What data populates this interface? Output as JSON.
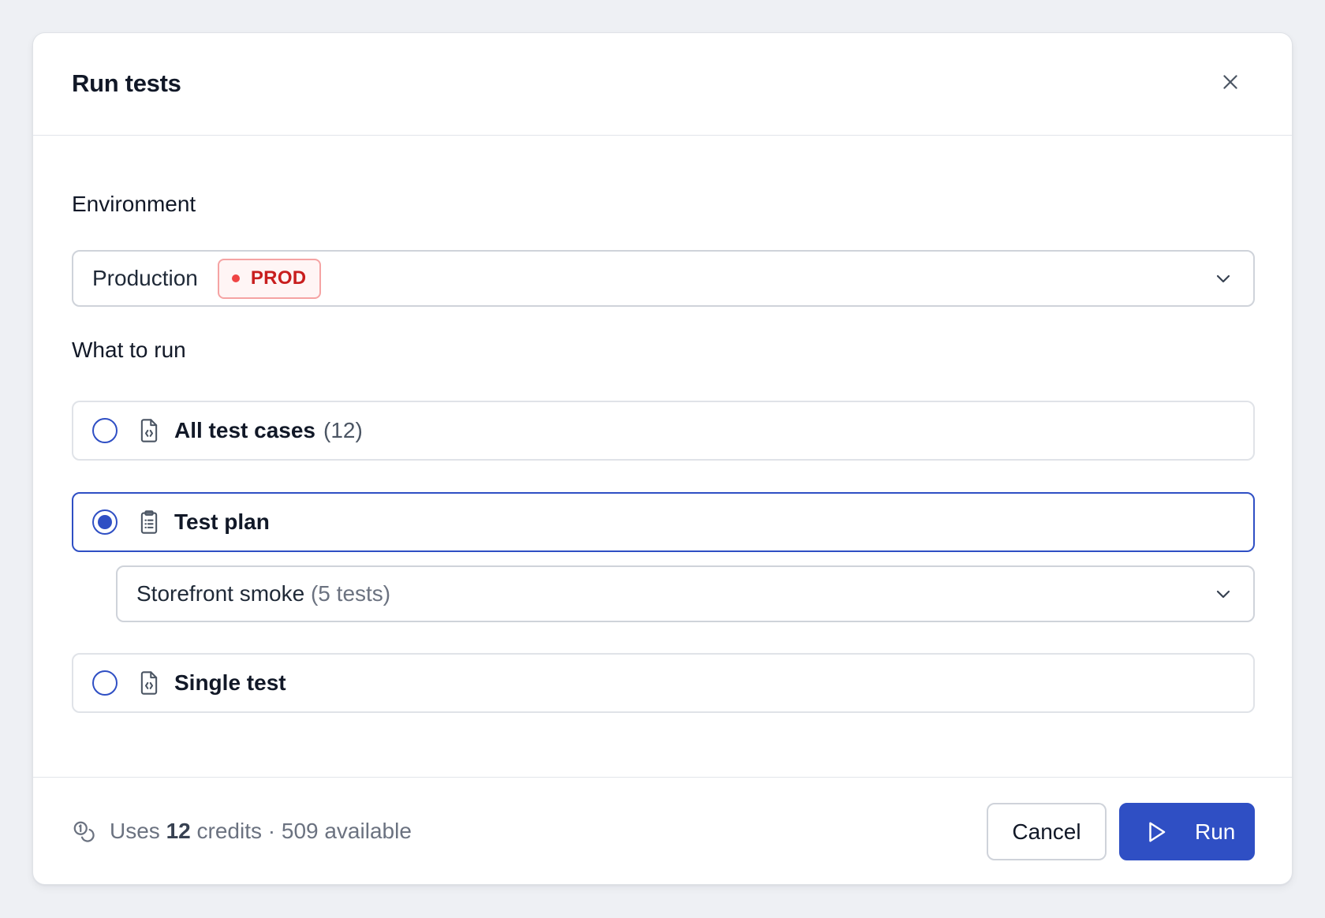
{
  "dialog": {
    "title": "Run tests",
    "close_icon": "close-icon"
  },
  "environment": {
    "label": "Environment",
    "selected": "Production",
    "badge": "PROD",
    "badge_color": "#c81e1e",
    "chevron_icon": "chevron-down-icon"
  },
  "what_to_run": {
    "label": "What to run",
    "options": [
      {
        "label": "All test cases",
        "count": "(12)",
        "icon": "file-code-icon",
        "selected": false
      },
      {
        "label": "Test plan",
        "count": "",
        "icon": "clipboard-list-icon",
        "selected": true
      },
      {
        "label": "Single test",
        "count": "",
        "icon": "file-code-icon",
        "selected": false
      }
    ],
    "plan_select": {
      "name": "Storefront smoke",
      "detail": "(5 tests)",
      "chevron_icon": "chevron-down-icon"
    }
  },
  "footer": {
    "credits_icon": "coins-icon",
    "uses_prefix": "Uses",
    "credits_count": "12",
    "credits_suffix": "credits · 509 available",
    "cancel_label": "Cancel",
    "run_label": "Run",
    "run_icon": "play-icon",
    "accent_color": "#2f4fc4"
  }
}
